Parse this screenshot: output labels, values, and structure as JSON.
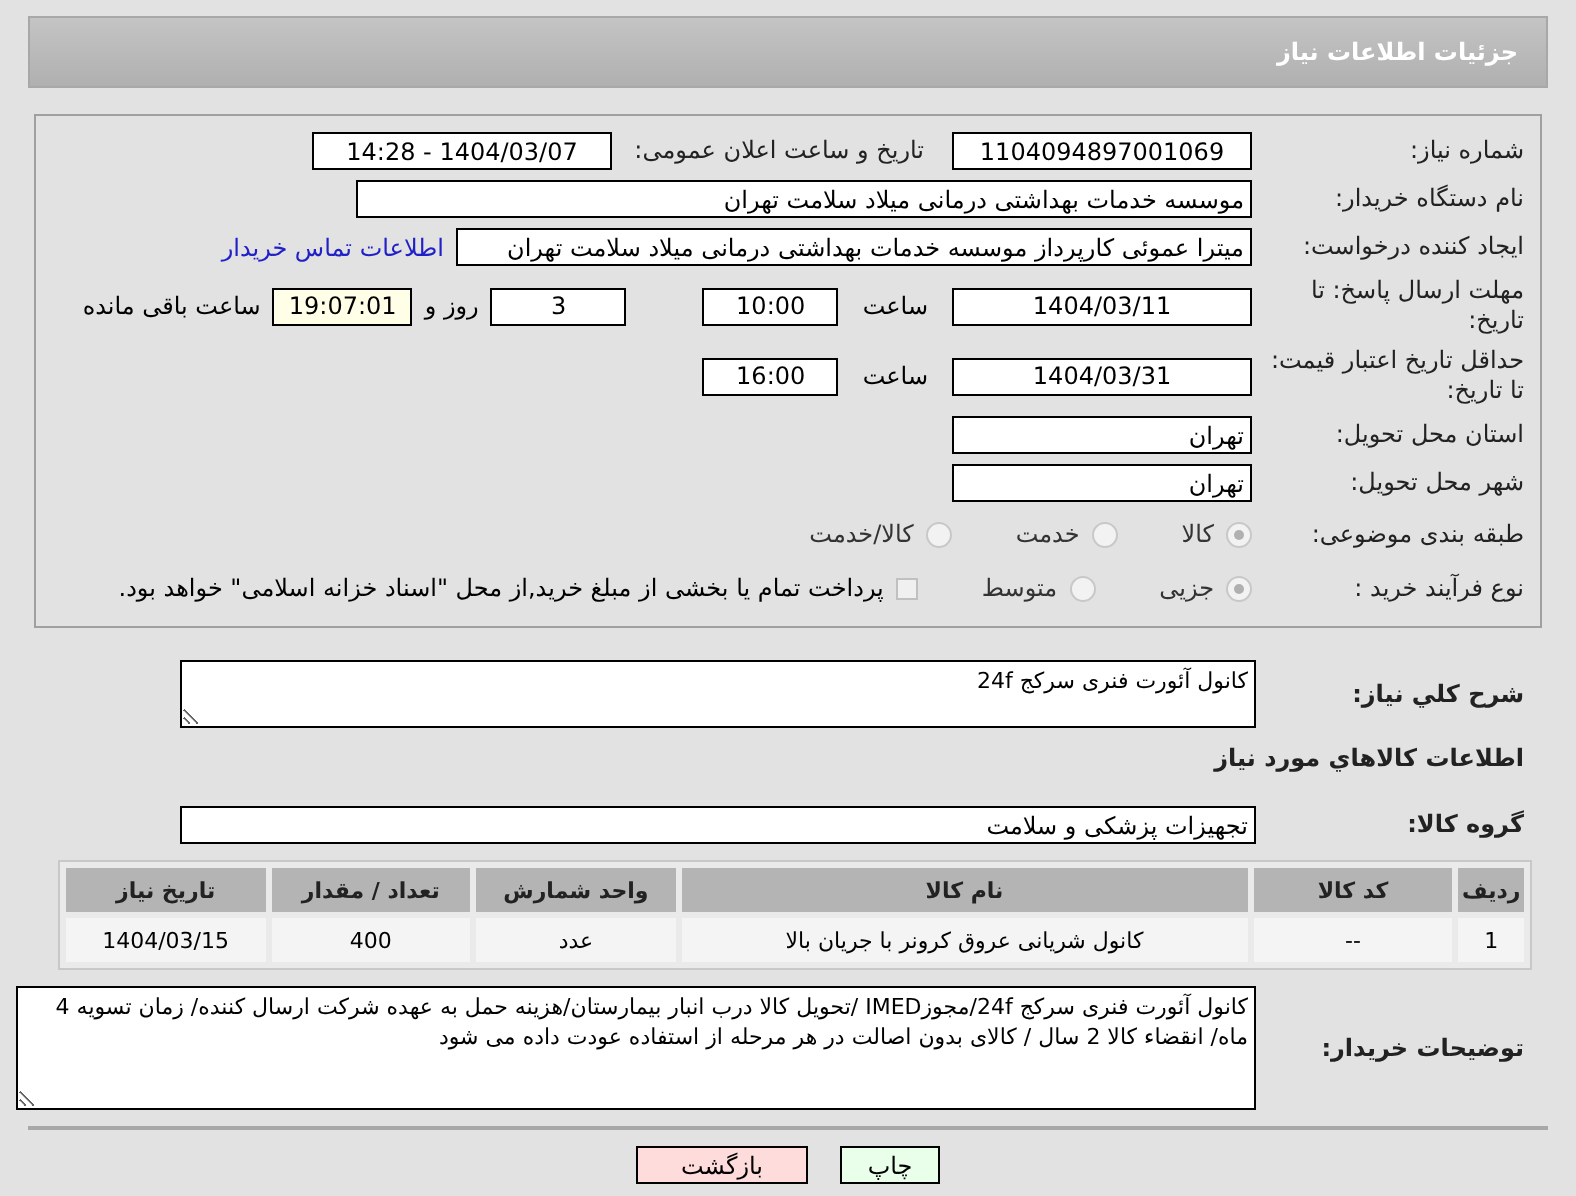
{
  "header": {
    "title": "جزئیات اطلاعات نیاز"
  },
  "need_number": {
    "label": "شماره نیاز:",
    "value": "1104094897001069"
  },
  "announce": {
    "label": "تاریخ و ساعت اعلان عمومی:",
    "value": "1404/03/07 - 14:28"
  },
  "buyer": {
    "label": "نام دستگاه خریدار:",
    "value": "موسسه خدمات بهداشتی درمانی میلاد سلامت تهران"
  },
  "requester": {
    "label": "ایجاد کننده درخواست:",
    "value": "میترا عموئی کارپرداز موسسه خدمات بهداشتی درمانی میلاد سلامت تهران",
    "link": "اطلاعات تماس خریدار"
  },
  "reply_deadline": {
    "label": "مهلت ارسال پاسخ: تا تاریخ:",
    "date": "1404/03/11",
    "time_label": "ساعت",
    "time": "10:00",
    "days": "3",
    "days_label": "روز و",
    "remaining": "19:07:01",
    "remaining_label": "ساعت باقی مانده"
  },
  "price_validity": {
    "label": "حداقل تاریخ اعتبار قیمت: تا تاریخ:",
    "date": "1404/03/31",
    "time_label": "ساعت",
    "time": "16:00"
  },
  "province": {
    "label": "استان محل تحویل:",
    "value": "تهران"
  },
  "city": {
    "label": "شهر محل تحویل:",
    "value": "تهران"
  },
  "category": {
    "label": "طبقه بندی موضوعی:",
    "options": [
      {
        "label": "کالا",
        "selected": true
      },
      {
        "label": "خدمت",
        "selected": false
      },
      {
        "label": "کالا/خدمت",
        "selected": false
      }
    ]
  },
  "process": {
    "label": "نوع فرآیند خرید :",
    "options": [
      {
        "label": "جزیی",
        "selected": true
      },
      {
        "label": "متوسط",
        "selected": false
      }
    ],
    "payment": {
      "checked": false,
      "text": "پرداخت تمام یا بخشی از مبلغ خرید,از محل \"اسناد خزانه اسلامی\" خواهد بود."
    }
  },
  "description": {
    "label": "شرح کلي نیاز:",
    "value": "کانول آئورت فنری سرکج 24f"
  },
  "goods_title": "اطلاعات کالاهاي مورد نیاز",
  "group": {
    "label": "گروه کالا:",
    "value": "تجهیزات پزشکی و سلامت"
  },
  "table": {
    "columns": [
      "ردیف",
      "کد کالا",
      "نام کالا",
      "واحد شمارش",
      "تعداد / مقدار",
      "تاریخ نیاز"
    ],
    "rows": [
      [
        "1",
        "--",
        "کانول شریانی عروق کرونر با جریان بالا",
        "عدد",
        "400",
        "1404/03/15"
      ]
    ]
  },
  "buyer_notes": {
    "label": "توضیحات خریدار:",
    "value": "کانول آئورت فنری سرکج 24f/مجوزIMED /تحویل کالا درب انبار بیمارستان/هزینه حمل به عهده شرکت ارسال کننده/ زمان تسویه 4 ماه/ انقضاء کالا 2 سال / کالای بدون اصالت در هر مرحله از استفاده عودت داده می شود"
  },
  "buttons": [
    {
      "label": "چاپ",
      "kind": "print"
    },
    {
      "label": "بازگشت",
      "kind": "back"
    }
  ]
}
